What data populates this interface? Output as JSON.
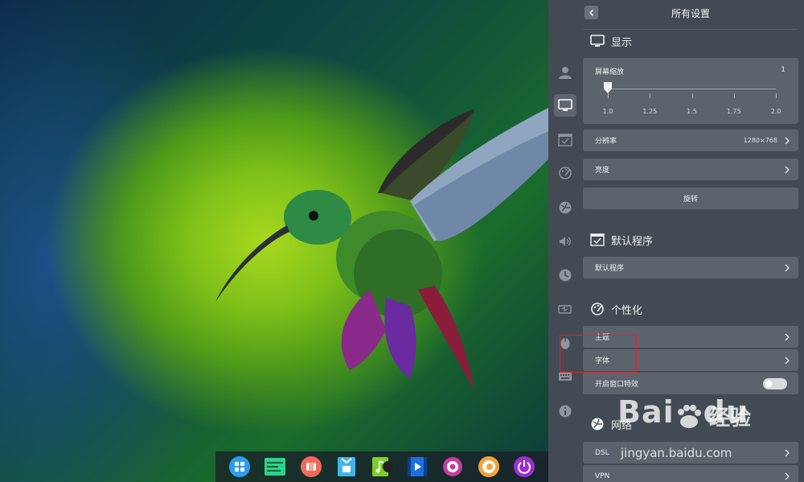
{
  "settings": {
    "title": "所有设置",
    "display": {
      "heading": "显示",
      "scale": {
        "label": "屏幕缩放",
        "value": "1",
        "ticks": [
          "1.0",
          "1.25",
          "1.5",
          "1.75",
          "2.0"
        ],
        "selected_fraction": 0.0
      },
      "resolution": {
        "label": "分辨率",
        "value": "1280×768"
      },
      "brightness": {
        "label": "亮度"
      },
      "rotate": {
        "label": "旋转"
      }
    },
    "default_apps": {
      "heading": "默认程序",
      "item": {
        "label": "默认程序"
      }
    },
    "personalization": {
      "heading": "个性化",
      "theme": {
        "label": "主题"
      },
      "font": {
        "label": "字体"
      },
      "window_effects": {
        "label": "开启窗口特效",
        "enabled": true
      }
    },
    "network": {
      "heading": "网络",
      "dsl": {
        "label": "DSL"
      },
      "vpn": {
        "label": "VPN"
      }
    },
    "sidebar_icons": [
      "user-icon",
      "display-icon",
      "default-apps-icon",
      "personalization-icon",
      "network-icon",
      "sound-icon",
      "time-icon",
      "power-icon",
      "mouse-icon",
      "keyboard-icon",
      "info-icon"
    ]
  },
  "dock": {
    "apps": [
      "launcher-icon",
      "terminal-icon",
      "store-icon",
      "file-manager-icon",
      "music-icon",
      "video-icon",
      "settings-icon",
      "browser-icon",
      "power-icon"
    ]
  },
  "watermark": {
    "logo": "Bai",
    "logo_tail": "du",
    "cn": "经验",
    "url": "jingyan.baidu.com"
  },
  "colors": {
    "panel_bg": "#434a53",
    "row_bg": "#5c636c",
    "highlight": "#e0242a"
  }
}
